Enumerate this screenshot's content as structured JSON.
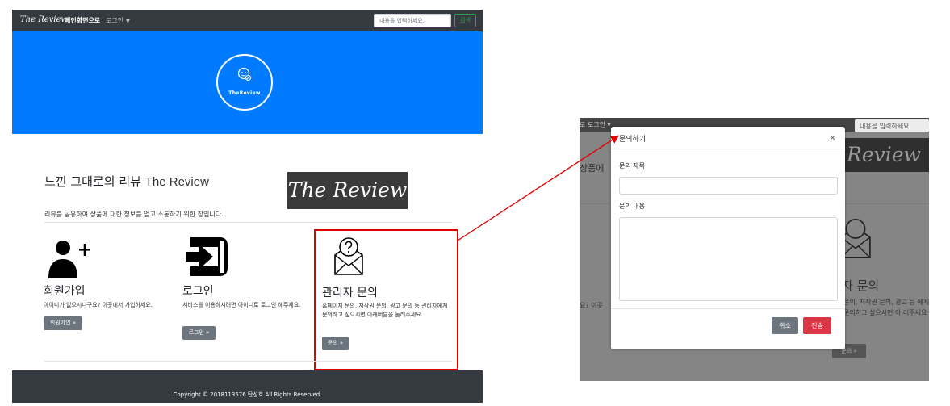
{
  "navbar": {
    "brand": "The Review",
    "home": "메인화면으로",
    "login": "로그인",
    "search_placeholder": "내용을 입력하세요.",
    "search_button": "검색"
  },
  "banner": {
    "logo_text": "TheReview"
  },
  "jumbotron": {
    "title_ko": "느낀 그대로의 리뷰",
    "title_en": "The Review",
    "description": "리뷰를 공유하여 상품에 대한 정보를 얻고 소통하기 위한 장입니다.",
    "logo_image_text": "The Review"
  },
  "features": [
    {
      "title": "회원가입",
      "description": "아이디가 없으시다구요? 이곳에서 가입하세요.",
      "button": "회원가입 »"
    },
    {
      "title": "로그인",
      "description": "서비스를 이용하시려면 아이디로 로그인 해주세요.",
      "button": "로그인 »"
    },
    {
      "title": "관리자 문의",
      "description": "홈페이지 문의, 저작권 문의, 광고 문의 등 관리자에게 문의하고 싶으시면 아래버튼을 눌러주세요.",
      "button": "문의 »"
    }
  ],
  "footer": {
    "copyright": "Copyright © 2018113576 탄성호 All Rights Reserved."
  },
  "modal_screenshot": {
    "bg_nav_text": "로 로그인 ▾",
    "bg_search": "내용을 입력하세요.",
    "bg_logo": "Review",
    "bg_text": "상품에",
    "bg_title": "자 문의",
    "bg_left_text": "요? 이곳",
    "bg_desc": "문의, 저작권 문의, 광고 등 에게 문의하고 싶으시면 아 러주세요",
    "bg_button": "문의 »",
    "modal": {
      "title": "문의하기",
      "close": "×",
      "subject_label": "문의 제목",
      "content_label": "문의 내용",
      "cancel": "취소",
      "send": "전송"
    }
  },
  "colors": {
    "navbar": "#343a40",
    "banner": "#007bff",
    "highlight": "#e00000",
    "send": "#dc3545",
    "secondary": "#6c757d"
  }
}
